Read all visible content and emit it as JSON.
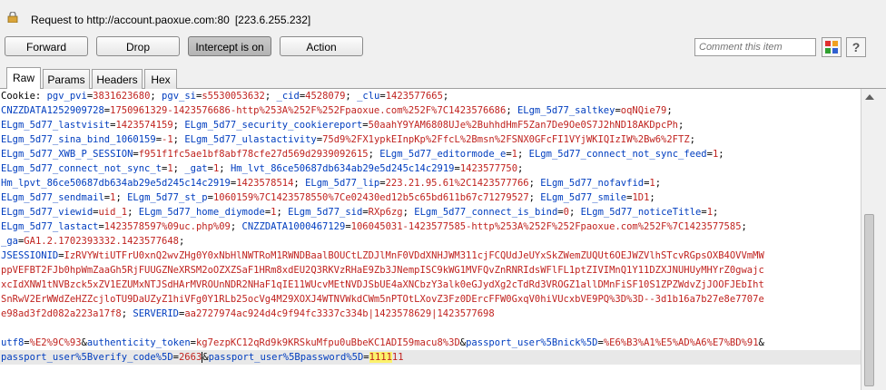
{
  "header": {
    "request_label": "Request to http://account.paoxue.com:80",
    "ip": "[223.6.255.232]"
  },
  "toolbar": {
    "forward": "Forward",
    "drop": "Drop",
    "intercept": "Intercept is on",
    "action": "Action",
    "comment_placeholder": "Comment this item",
    "help": "?"
  },
  "tabs": [
    "Raw",
    "Params",
    "Headers",
    "Hex"
  ],
  "active_tab": "Raw",
  "colors": {
    "key": "#003dbf",
    "value": "#c0231f",
    "selection": "#fbf26c",
    "active_button": "#bfbfbf"
  },
  "editor": {
    "lines": [
      [
        [
          "p",
          "Cookie: "
        ],
        [
          "k",
          "pgv_pvi"
        ],
        [
          "p",
          "="
        ],
        [
          "v",
          "3831623680"
        ],
        [
          "p",
          "; "
        ],
        [
          "k",
          "pgv_si"
        ],
        [
          "p",
          "="
        ],
        [
          "v",
          "s5530053632"
        ],
        [
          "p",
          "; "
        ],
        [
          "k",
          "_cid"
        ],
        [
          "p",
          "="
        ],
        [
          "v",
          "4528079"
        ],
        [
          "p",
          "; "
        ],
        [
          "k",
          "_clu"
        ],
        [
          "p",
          "="
        ],
        [
          "v",
          "1423577665"
        ],
        [
          "p",
          ";"
        ]
      ],
      [
        [
          "k",
          "CNZZDATA1252909728"
        ],
        [
          "p",
          "="
        ],
        [
          "v",
          "1750961329-1423576686-http%253A%252F%252Fpaoxue.com%252F%7C1423576686"
        ],
        [
          "p",
          "; "
        ],
        [
          "k",
          "ELgm_5d77_saltkey"
        ],
        [
          "p",
          "="
        ],
        [
          "v",
          "oqNQie79"
        ],
        [
          "p",
          ";"
        ]
      ],
      [
        [
          "k",
          "ELgm_5d77_lastvisit"
        ],
        [
          "p",
          "="
        ],
        [
          "v",
          "1423574159"
        ],
        [
          "p",
          "; "
        ],
        [
          "k",
          "ELgm_5d77_security_cookiereport"
        ],
        [
          "p",
          "="
        ],
        [
          "v",
          "50aahY9YAM6808UJe%2BuhhdHmF5Zan7De9Oe0S7J2hND18AKDpcPh"
        ],
        [
          "p",
          ";"
        ]
      ],
      [
        [
          "k",
          "ELgm_5d77_sina_bind_1060159"
        ],
        [
          "p",
          "="
        ],
        [
          "v",
          "-1"
        ],
        [
          "p",
          "; "
        ],
        [
          "k",
          "ELgm_5d77_ulastactivity"
        ],
        [
          "p",
          "="
        ],
        [
          "v",
          "75d9%2FX1ypkEInpKp%2FfcL%2Bmsn%2FSNX0GFcFI1VYjWKIQIzIW%2Bw6%2FTZ"
        ],
        [
          "p",
          ";"
        ]
      ],
      [
        [
          "k",
          "ELgm_5d77_XWB_P_SESSION"
        ],
        [
          "p",
          "="
        ],
        [
          "v",
          "f951f1fc5ae1bf8abf78cfe27d569d2939092615"
        ],
        [
          "p",
          "; "
        ],
        [
          "k",
          "ELgm_5d77_editormode_e"
        ],
        [
          "p",
          "="
        ],
        [
          "v",
          "1"
        ],
        [
          "p",
          "; "
        ],
        [
          "k",
          "ELgm_5d77_connect_not_sync_feed"
        ],
        [
          "p",
          "="
        ],
        [
          "v",
          "1"
        ],
        [
          "p",
          ";"
        ]
      ],
      [
        [
          "k",
          "ELgm_5d77_connect_not_sync_t"
        ],
        [
          "p",
          "="
        ],
        [
          "v",
          "1"
        ],
        [
          "p",
          "; "
        ],
        [
          "k",
          "_gat"
        ],
        [
          "p",
          "="
        ],
        [
          "v",
          "1"
        ],
        [
          "p",
          "; "
        ],
        [
          "k",
          "Hm_lvt_86ce50687db634ab29e5d245c14c2919"
        ],
        [
          "p",
          "="
        ],
        [
          "v",
          "1423577750"
        ],
        [
          "p",
          ";"
        ]
      ],
      [
        [
          "k",
          "Hm_lpvt_86ce50687db634ab29e5d245c14c2919"
        ],
        [
          "p",
          "="
        ],
        [
          "v",
          "1423578514"
        ],
        [
          "p",
          "; "
        ],
        [
          "k",
          "ELgm_5d77_lip"
        ],
        [
          "p",
          "="
        ],
        [
          "v",
          "223.21.95.61%2C1423577766"
        ],
        [
          "p",
          "; "
        ],
        [
          "k",
          "ELgm_5d77_nofavfid"
        ],
        [
          "p",
          "="
        ],
        [
          "v",
          "1"
        ],
        [
          "p",
          ";"
        ]
      ],
      [
        [
          "k",
          "ELgm_5d77_sendmail"
        ],
        [
          "p",
          "="
        ],
        [
          "v",
          "1"
        ],
        [
          "p",
          "; "
        ],
        [
          "k",
          "ELgm_5d77_st_p"
        ],
        [
          "p",
          "="
        ],
        [
          "v",
          "1060159%7C1423578550%7Ce02430ed12b5c65bd611b67c71279527"
        ],
        [
          "p",
          "; "
        ],
        [
          "k",
          "ELgm_5d77_smile"
        ],
        [
          "p",
          "="
        ],
        [
          "v",
          "1D1"
        ],
        [
          "p",
          ";"
        ]
      ],
      [
        [
          "k",
          "ELgm_5d77_viewid"
        ],
        [
          "p",
          "="
        ],
        [
          "v",
          "uid_1"
        ],
        [
          "p",
          "; "
        ],
        [
          "k",
          "ELgm_5d77_home_diymode"
        ],
        [
          "p",
          "="
        ],
        [
          "v",
          "1"
        ],
        [
          "p",
          "; "
        ],
        [
          "k",
          "ELgm_5d77_sid"
        ],
        [
          "p",
          "="
        ],
        [
          "v",
          "RXp6zg"
        ],
        [
          "p",
          "; "
        ],
        [
          "k",
          "ELgm_5d77_connect_is_bind"
        ],
        [
          "p",
          "="
        ],
        [
          "v",
          "0"
        ],
        [
          "p",
          "; "
        ],
        [
          "k",
          "ELgm_5d77_noticeTitle"
        ],
        [
          "p",
          "="
        ],
        [
          "v",
          "1"
        ],
        [
          "p",
          ";"
        ]
      ],
      [
        [
          "k",
          "ELgm_5d77_lastact"
        ],
        [
          "p",
          "="
        ],
        [
          "v",
          "1423578597%09uc.php%09"
        ],
        [
          "p",
          "; "
        ],
        [
          "k",
          "CNZZDATA1000467129"
        ],
        [
          "p",
          "="
        ],
        [
          "v",
          "106045031-1423577585-http%253A%252F%252Fpaoxue.com%252F%7C1423577585"
        ],
        [
          "p",
          ";"
        ]
      ],
      [
        [
          "k",
          "_ga"
        ],
        [
          "p",
          "="
        ],
        [
          "v",
          "GA1.2.1702393332.1423577648"
        ],
        [
          "p",
          ";"
        ]
      ],
      [
        [
          "k",
          "JSESSIONID"
        ],
        [
          "p",
          "="
        ],
        [
          "v",
          "IzRVYWtiUTFrU0xnQ2wvZHg0Y0xNbHlNWTRoM1RWNDBaalBOUCtLZDJlMnF0VDdXNHJWM311cjFCQUdJeUYxSkZWemZUQUt6OEJWZVlhSTcvRGpsOXB4OVVmMW"
        ]
      ],
      [
        [
          "v",
          "ppVEFBT2FJb0hpWmZaaGh5RjFUUGZNeXRSM2oOZXZSaF1HRm8xdEU2Q3RKVzRHaE9Zb3JNempISC9kWG1MVFQvZnRNRIdsWFlFL1ptZIVIMnQ1Y11DZXJNUHUyMHYrZ0gwajc"
        ]
      ],
      [
        [
          "v",
          "xcIdXNW1tNVBzck5xZV1EZUMxNTJSdHArMVROUnNDR2NHaF1qIE11WUcvMEtNVDJSbUE4aXNCbzY3alk0eGJydXg2cTdRd3VROGZ1allDMnFiSF10S1ZPZWdvZjJOOFJEbIht"
        ]
      ],
      [
        [
          "v",
          "SnRwV2ErWWdZeHZZcjloTU9DaUZyZ1hiVFg0Y1RLb25ocVg4M29XOXJ4WTNVWkdCWm5nPTOtLXovZ3Fz0DErcFFW0GxqV0hiVUcxbVE9PQ%3D%3D--3d1b16a7b27e8e7707e"
        ]
      ],
      [
        [
          "v",
          "e98ad3f2d082a223a17f8"
        ],
        [
          "p",
          "; "
        ],
        [
          "k",
          "SERVERID"
        ],
        [
          "p",
          "="
        ],
        [
          "v",
          "aa2727974ac924d4c9f94fc3337c334b|1423578629|1423577698"
        ]
      ],
      [
        [
          "p",
          " "
        ]
      ],
      [
        [
          "k",
          "utf8"
        ],
        [
          "p",
          "="
        ],
        [
          "v",
          "%E2%9C%93"
        ],
        [
          "p",
          "&"
        ],
        [
          "k",
          "authenticity_token"
        ],
        [
          "p",
          "="
        ],
        [
          "v",
          "kg7ezpKC12qRd9k9KRSkuMfpu0uBbeKC1ADI59macu8%3D"
        ],
        [
          "p",
          "&"
        ],
        [
          "k",
          "passport_user%5Bnick%5D"
        ],
        [
          "p",
          "="
        ],
        [
          "v",
          "%E6%B3%A1%E5%AD%A6%E7%BD%91"
        ],
        [
          "p",
          "&"
        ]
      ],
      [
        [
          "k",
          "passport_user%5Bverify_code%5D"
        ],
        [
          "p",
          "="
        ],
        [
          "v",
          "2663"
        ],
        [
          "c",
          ""
        ],
        [
          "p",
          "&"
        ],
        [
          "k",
          "passport_user%5Bpassword%5D"
        ],
        [
          "p",
          "="
        ],
        [
          "s",
          "1111"
        ],
        [
          "v",
          "11"
        ]
      ]
    ]
  }
}
